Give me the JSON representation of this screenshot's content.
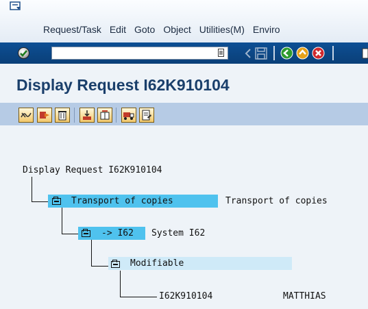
{
  "menu": {
    "items": [
      "Request/Task",
      "Edit",
      "Goto",
      "Object",
      "Utilities(M)",
      "Enviro"
    ]
  },
  "toolbar": {
    "command_value": "",
    "icons": [
      "enter-icon",
      "command-history-icon",
      "back-arrow-icon",
      "save-icon",
      "back-icon",
      "exit-icon",
      "cancel-icon",
      "print-icon"
    ]
  },
  "title": "Display Request I62K910104",
  "app_toolbar": {
    "icons": [
      "display-change-icon",
      "object-list-icon",
      "delete-icon",
      "release-icon",
      "merge-icon",
      "transport-truck-icon",
      "documentation-icon"
    ]
  },
  "tree": {
    "root": "Display Request I62K910104",
    "node1": {
      "label": "Transport of copies",
      "description": "Transport of copies"
    },
    "node2": {
      "label": "-> I62",
      "description": "System I62"
    },
    "node3": {
      "label": "Modifiable"
    },
    "node4": {
      "label": "I62K910104",
      "owner": "MATTHIAS"
    }
  },
  "colors": {
    "toolbar_blue": "#0d4f94",
    "title_blue": "#1a3f6b",
    "selection": "#4fc2ee",
    "selection_light": "#cfeaf8"
  }
}
